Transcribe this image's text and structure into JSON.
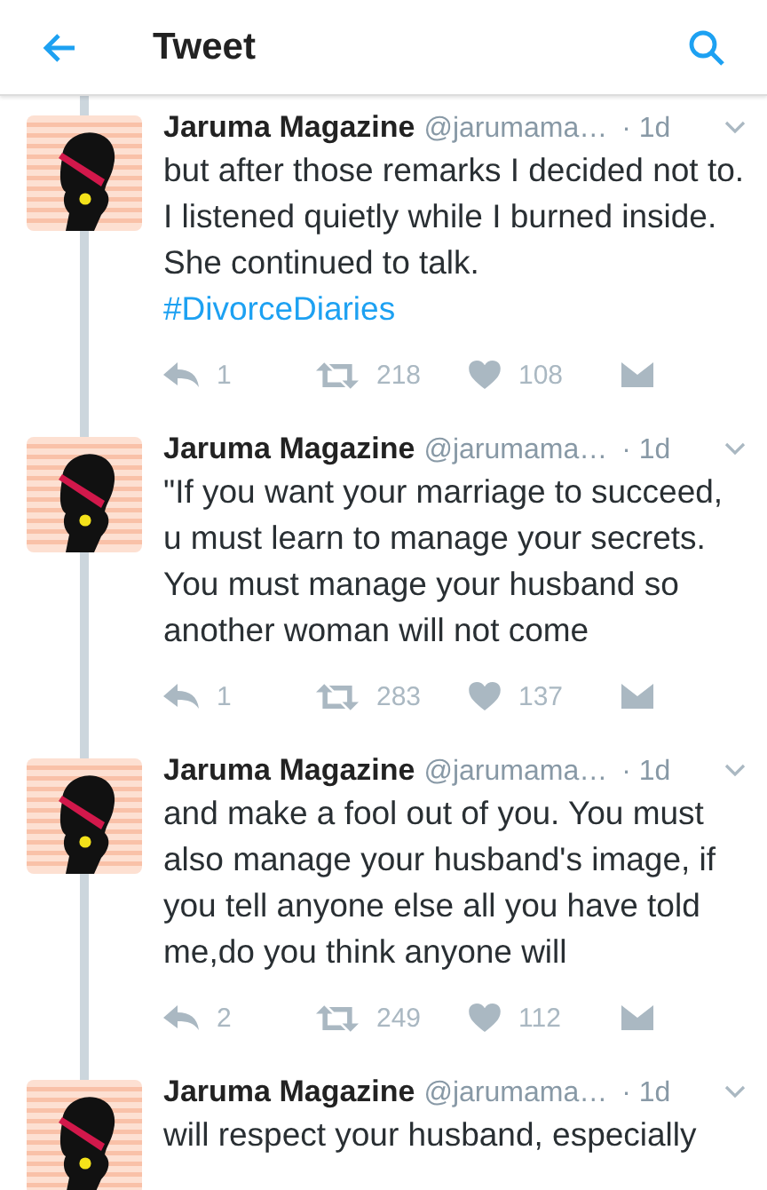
{
  "header": {
    "title": "Tweet"
  },
  "tweets": [
    {
      "name": "Jaruma Magazine",
      "handle": "@jarumama…",
      "time": "· 1d",
      "text": "but after those remarks I decided not to. I listened quietly while I burned inside. She continued to talk.",
      "hashtag": "#DivorceDiaries",
      "actions": {
        "replies": "1",
        "retweets": "218",
        "likes": "108"
      }
    },
    {
      "name": "Jaruma Magazine",
      "handle": "@jarumama…",
      "time": "· 1d",
      "text": "\"If you want your marriage to succeed, u must learn to manage your secrets. You must manage your husband so another woman will not come",
      "actions": {
        "replies": "1",
        "retweets": "283",
        "likes": "137"
      }
    },
    {
      "name": "Jaruma Magazine",
      "handle": "@jarumama…",
      "time": "· 1d",
      "text": "and make a fool out of you. You must also manage your husband's image, if you tell anyone else all you have told me,do you think anyone will",
      "actions": {
        "replies": "2",
        "retweets": "249",
        "likes": "112"
      }
    },
    {
      "name": "Jaruma Magazine",
      "handle": "@jarumama…",
      "time": "· 1d",
      "text": "will respect your husband, especially"
    }
  ]
}
